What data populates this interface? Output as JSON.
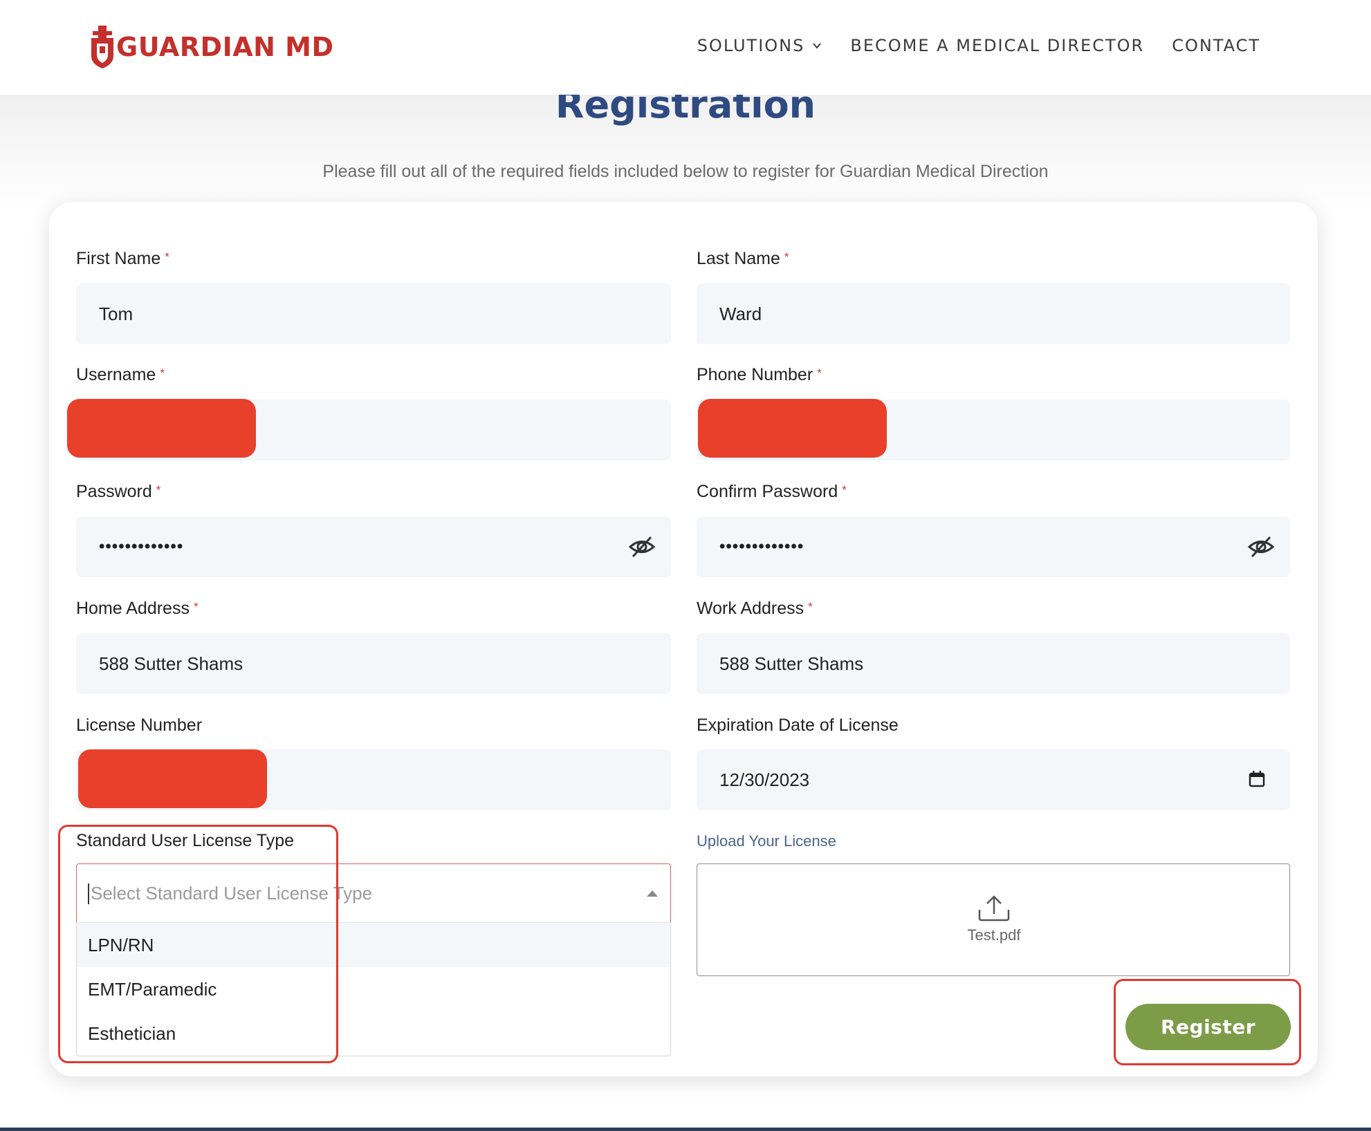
{
  "header": {
    "logo_text": "GUARDIAN MD",
    "nav": [
      {
        "label": "SOLUTIONS"
      },
      {
        "label": "BECOME A MEDICAL DIRECTOR"
      },
      {
        "label": "CONTACT"
      }
    ]
  },
  "page": {
    "title": "Registration",
    "subtitle": "Please fill out all of the required fields included below to register for Guardian Medical Direction"
  },
  "form": {
    "first_name": {
      "label": "First Name",
      "required_mark": "*",
      "value": "Tom"
    },
    "last_name": {
      "label": "Last Name",
      "required_mark": "*",
      "value": "Ward"
    },
    "username": {
      "label": "Username",
      "required_mark": "*"
    },
    "phone": {
      "label": "Phone Number",
      "required_mark": "*"
    },
    "password": {
      "label": "Password",
      "required_mark": "*",
      "value": "•••••••••••••"
    },
    "confirm_password": {
      "label": "Confirm Password",
      "required_mark": "*",
      "value": "•••••••••••••"
    },
    "home_address": {
      "label": "Home Address",
      "required_mark": "*",
      "value": "588 Sutter Shams"
    },
    "work_address": {
      "label": "Work Address",
      "required_mark": "*",
      "value": "588 Sutter Shams"
    },
    "license_number": {
      "label": "License Number"
    },
    "expiration": {
      "label": "Expiration Date of License",
      "value": "12/30/2023"
    },
    "license_type": {
      "label": "Standard User License Type",
      "placeholder": "Select Standard User License Type",
      "options": [
        "LPN/RN",
        "EMT/Paramedic",
        "Esthetician"
      ]
    },
    "upload": {
      "label": "Upload Your License",
      "filename": "Test.pdf"
    },
    "submit_label": "Register"
  },
  "colors": {
    "brand_red": "#c4302b",
    "title_blue": "#2f4a80",
    "button_green": "#7d9c48",
    "redaction": "#e8402b",
    "annotation_red": "#e0392f"
  }
}
